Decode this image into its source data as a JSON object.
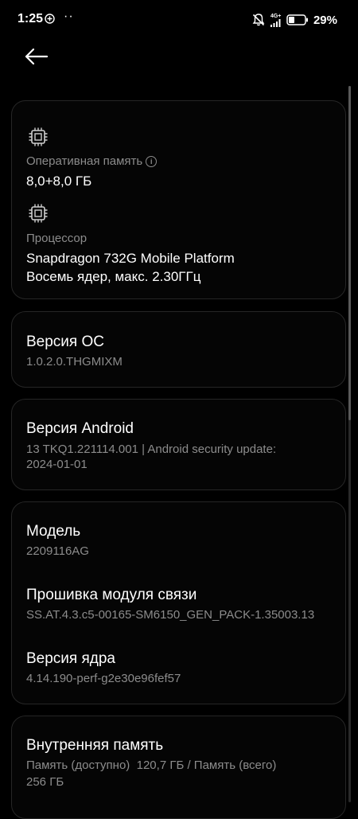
{
  "status_bar": {
    "time": "1:25",
    "network": "4G+",
    "battery_percent": "29%",
    "icons": [
      "plus-circle-icon",
      "more-dots-icon",
      "bell-muted-icon",
      "signal-icon",
      "battery-icon"
    ]
  },
  "nav": {
    "back_icon": "arrow-left-icon"
  },
  "hardware": {
    "ram": {
      "icon": "chip-icon",
      "label": "Оперативная память",
      "value": "8,0+8,0 ГБ"
    },
    "cpu": {
      "icon": "chip-icon",
      "label": "Процессор",
      "value_line1": "Snapdragon 732G Mobile Platform",
      "value_line2": "Восемь ядер, макс. 2.30ГГц"
    }
  },
  "os_version": {
    "title": "Версия ОС",
    "value": "1.0.2.0.THGMIXM"
  },
  "android_version": {
    "title": "Версия Android",
    "value_line1": "13 TKQ1.221114.001 | Android security update:",
    "value_line2": "2024-01-01"
  },
  "device": {
    "model": {
      "title": "Модель",
      "value": "2209116AG"
    },
    "baseband": {
      "title": "Прошивка модуля связи",
      "value": "SS.AT.4.3.c5-00165-SM6150_GEN_PACK-1.35003.13"
    },
    "kernel": {
      "title": "Версия ядра",
      "value": "4.14.190-perf-g2e30e96fef57"
    }
  },
  "storage": {
    "title": "Внутренняя память",
    "value_line1": "Память (доступно)  120,7 ГБ / Память (всего)",
    "value_line2": "256 ГБ"
  }
}
